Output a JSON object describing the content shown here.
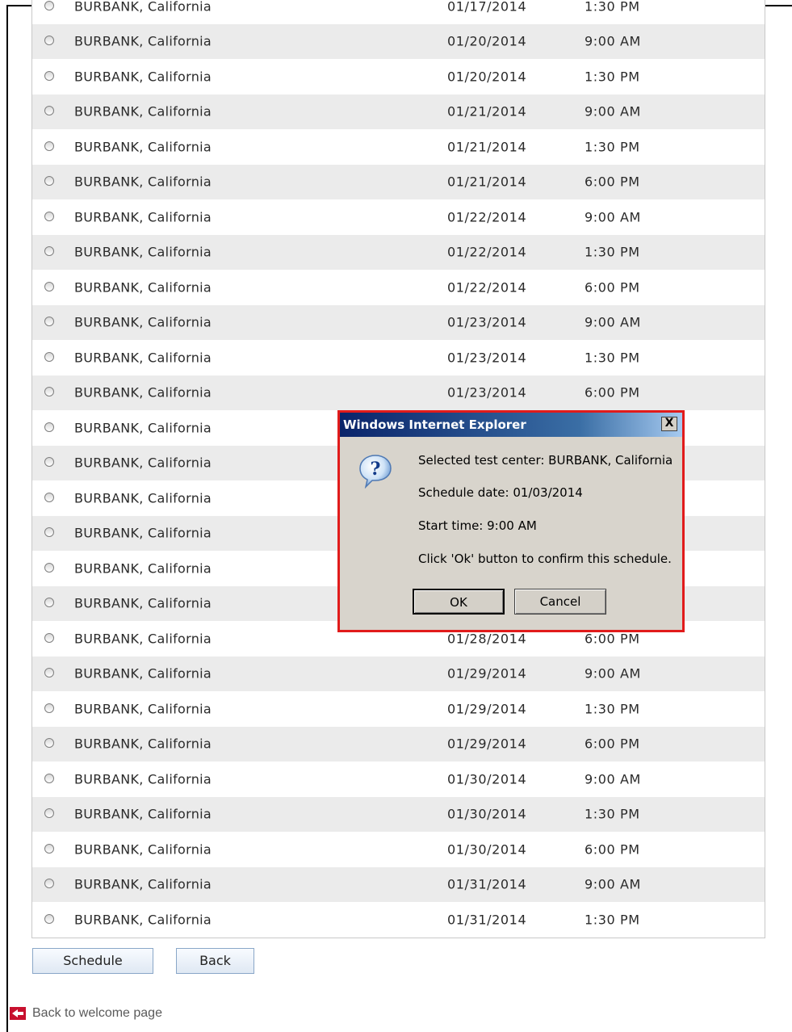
{
  "schedule": {
    "rows": [
      {
        "location": "BURBANK, California",
        "date": "01/17/2014",
        "time": "1:30 PM"
      },
      {
        "location": "BURBANK, California",
        "date": "01/20/2014",
        "time": "9:00 AM"
      },
      {
        "location": "BURBANK, California",
        "date": "01/20/2014",
        "time": "1:30 PM"
      },
      {
        "location": "BURBANK, California",
        "date": "01/21/2014",
        "time": "9:00 AM"
      },
      {
        "location": "BURBANK, California",
        "date": "01/21/2014",
        "time": "1:30 PM"
      },
      {
        "location": "BURBANK, California",
        "date": "01/21/2014",
        "time": "6:00 PM"
      },
      {
        "location": "BURBANK, California",
        "date": "01/22/2014",
        "time": "9:00 AM"
      },
      {
        "location": "BURBANK, California",
        "date": "01/22/2014",
        "time": "1:30 PM"
      },
      {
        "location": "BURBANK, California",
        "date": "01/22/2014",
        "time": "6:00 PM"
      },
      {
        "location": "BURBANK, California",
        "date": "01/23/2014",
        "time": "9:00 AM"
      },
      {
        "location": "BURBANK, California",
        "date": "01/23/2014",
        "time": "1:30 PM"
      },
      {
        "location": "BURBANK, California",
        "date": "01/23/2014",
        "time": "6:00 PM"
      },
      {
        "location": "BURBANK, California",
        "date": "",
        "time": ""
      },
      {
        "location": "BURBANK, California",
        "date": "",
        "time": ""
      },
      {
        "location": "BURBANK, California",
        "date": "",
        "time": ""
      },
      {
        "location": "BURBANK, California",
        "date": "",
        "time": ""
      },
      {
        "location": "BURBANK, California",
        "date": "",
        "time": ""
      },
      {
        "location": "BURBANK, California",
        "date": "",
        "time": ""
      },
      {
        "location": "BURBANK, California",
        "date": "01/28/2014",
        "time": "6:00 PM"
      },
      {
        "location": "BURBANK, California",
        "date": "01/29/2014",
        "time": "9:00 AM"
      },
      {
        "location": "BURBANK, California",
        "date": "01/29/2014",
        "time": "1:30 PM"
      },
      {
        "location": "BURBANK, California",
        "date": "01/29/2014",
        "time": "6:00 PM"
      },
      {
        "location": "BURBANK, California",
        "date": "01/30/2014",
        "time": "9:00 AM"
      },
      {
        "location": "BURBANK, California",
        "date": "01/30/2014",
        "time": "1:30 PM"
      },
      {
        "location": "BURBANK, California",
        "date": "01/30/2014",
        "time": "6:00 PM"
      },
      {
        "location": "BURBANK, California",
        "date": "01/31/2014",
        "time": "9:00 AM"
      },
      {
        "location": "BURBANK, California",
        "date": "01/31/2014",
        "time": "1:30 PM"
      }
    ]
  },
  "buttons": {
    "schedule": "Schedule",
    "back": "Back"
  },
  "welcome_link": "Back to welcome page",
  "dialog": {
    "title": "Windows Internet Explorer",
    "close_glyph": "X",
    "icon": "question-icon",
    "lines": [
      "Selected test center: BURBANK, California",
      "Schedule date: 01/03/2014",
      "Start time: 9:00 AM",
      "Click 'Ok' button to confirm this schedule."
    ],
    "ok": "OK",
    "cancel": "Cancel"
  },
  "colors": {
    "dialog_highlight": "#e11b1b",
    "row_alt": "#ebebeb",
    "welcome_arrow": "#c8102e"
  }
}
